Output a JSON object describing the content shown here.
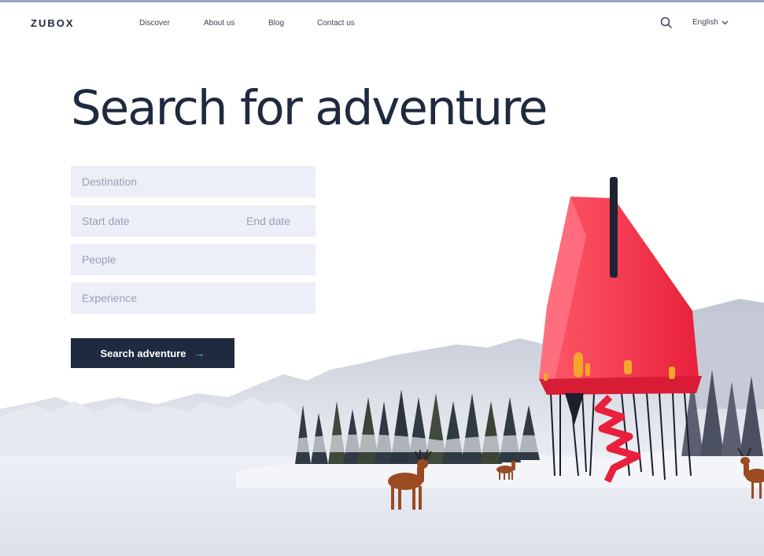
{
  "nav": {
    "logo": "ZUBOX",
    "links": [
      "Discover",
      "About us",
      "Blog",
      "Contact us"
    ],
    "language": "English",
    "icons": {
      "search": "search-icon",
      "language_dropdown": "chevron-down-icon"
    }
  },
  "hero": {
    "headline": "Search for adventure",
    "form": {
      "destination_placeholder": "Destination",
      "start_date_placeholder": "Start date",
      "end_date_placeholder": "End date",
      "people_placeholder": "People",
      "experience_placeholder": "Experience"
    },
    "cta_label": "Search adventure",
    "cta_icon": "arrow-right-icon"
  },
  "colors": {
    "primary": "#1f2a3f",
    "accent_arrow": "#58c4e0",
    "field_bg": "#eceff8",
    "house_red": "#ef2a44"
  }
}
